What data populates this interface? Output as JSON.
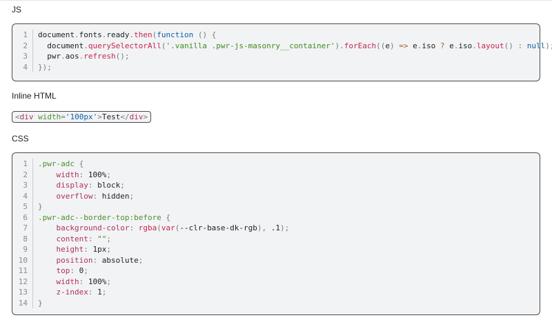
{
  "sections": {
    "js_label": "JS",
    "html_label": "Inline HTML",
    "css_label": "CSS"
  },
  "js_code": [
    {
      "n": "1",
      "tokens": [
        {
          "t": "document",
          "c": "t-obj"
        },
        {
          "t": ".",
          "c": "t-punc"
        },
        {
          "t": "fonts",
          "c": "t-obj"
        },
        {
          "t": ".",
          "c": "t-punc"
        },
        {
          "t": "ready",
          "c": "t-obj"
        },
        {
          "t": ".",
          "c": "t-punc"
        },
        {
          "t": "then",
          "c": "t-fn"
        },
        {
          "t": "(",
          "c": "t-punc"
        },
        {
          "t": "function",
          "c": "t-kw"
        },
        {
          "t": " ",
          "c": "t-obj"
        },
        {
          "t": "()",
          "c": "t-punc"
        },
        {
          "t": " ",
          "c": "t-obj"
        },
        {
          "t": "{",
          "c": "t-punc"
        }
      ]
    },
    {
      "n": "2",
      "tokens": [
        {
          "t": "  document",
          "c": "t-obj"
        },
        {
          "t": ".",
          "c": "t-punc"
        },
        {
          "t": "querySelectorAll",
          "c": "t-fn"
        },
        {
          "t": "(",
          "c": "t-punc"
        },
        {
          "t": "'.vanilla .pwr-js-masonry__container'",
          "c": "t-str"
        },
        {
          "t": ")",
          "c": "t-punc"
        },
        {
          "t": ".",
          "c": "t-punc"
        },
        {
          "t": "forEach",
          "c": "t-fn"
        },
        {
          "t": "((",
          "c": "t-punc"
        },
        {
          "t": "e",
          "c": "t-obj"
        },
        {
          "t": ")",
          "c": "t-punc"
        },
        {
          "t": " => ",
          "c": "t-op"
        },
        {
          "t": "e",
          "c": "t-obj"
        },
        {
          "t": ".",
          "c": "t-punc"
        },
        {
          "t": "iso",
          "c": "t-obj"
        },
        {
          "t": " ? ",
          "c": "t-op"
        },
        {
          "t": "e",
          "c": "t-obj"
        },
        {
          "t": ".",
          "c": "t-punc"
        },
        {
          "t": "iso",
          "c": "t-obj"
        },
        {
          "t": ".",
          "c": "t-punc"
        },
        {
          "t": "layout",
          "c": "t-fn"
        },
        {
          "t": "()",
          "c": "t-punc"
        },
        {
          "t": " : ",
          "c": "t-op"
        },
        {
          "t": "null",
          "c": "t-kw"
        },
        {
          "t": ");",
          "c": "t-punc"
        }
      ]
    },
    {
      "n": "3",
      "tokens": [
        {
          "t": "  pwr",
          "c": "t-obj"
        },
        {
          "t": ".",
          "c": "t-punc"
        },
        {
          "t": "aos",
          "c": "t-obj"
        },
        {
          "t": ".",
          "c": "t-punc"
        },
        {
          "t": "refresh",
          "c": "t-fn"
        },
        {
          "t": "();",
          "c": "t-punc"
        }
      ]
    },
    {
      "n": "4",
      "tokens": [
        {
          "t": "});",
          "c": "t-punc"
        }
      ]
    }
  ],
  "inline_html": [
    {
      "t": "<",
      "c": "t-punc"
    },
    {
      "t": "div",
      "c": "t-tag"
    },
    {
      "t": " ",
      "c": "t-obj"
    },
    {
      "t": "width",
      "c": "t-attr"
    },
    {
      "t": "=",
      "c": "t-punc"
    },
    {
      "t": "'100px'",
      "c": "t-kw"
    },
    {
      "t": ">",
      "c": "t-punc"
    },
    {
      "t": "Test",
      "c": "t-obj"
    },
    {
      "t": "</",
      "c": "t-punc"
    },
    {
      "t": "div",
      "c": "t-tag"
    },
    {
      "t": ">",
      "c": "t-punc"
    }
  ],
  "css_code": [
    {
      "n": "1",
      "tokens": [
        {
          "t": ".pwr-adc",
          "c": "t-sel"
        },
        {
          "t": " {",
          "c": "t-punc"
        }
      ]
    },
    {
      "n": "2",
      "tokens": [
        {
          "t": "    width",
          "c": "t-prop"
        },
        {
          "t": ": ",
          "c": "t-punc"
        },
        {
          "t": "100%",
          "c": "t-val"
        },
        {
          "t": ";",
          "c": "t-punc"
        }
      ]
    },
    {
      "n": "3",
      "tokens": [
        {
          "t": "    display",
          "c": "t-prop"
        },
        {
          "t": ": ",
          "c": "t-punc"
        },
        {
          "t": "block",
          "c": "t-val"
        },
        {
          "t": ";",
          "c": "t-punc"
        }
      ]
    },
    {
      "n": "4",
      "tokens": [
        {
          "t": "    overflow",
          "c": "t-prop"
        },
        {
          "t": ": ",
          "c": "t-punc"
        },
        {
          "t": "hidden",
          "c": "t-val"
        },
        {
          "t": ";",
          "c": "t-punc"
        }
      ]
    },
    {
      "n": "5",
      "tokens": [
        {
          "t": "}",
          "c": "t-punc"
        }
      ]
    },
    {
      "n": "6",
      "tokens": [
        {
          "t": ".pwr-adc--border-top:before",
          "c": "t-sel"
        },
        {
          "t": " {",
          "c": "t-punc"
        }
      ]
    },
    {
      "n": "7",
      "tokens": [
        {
          "t": "    background-color",
          "c": "t-prop"
        },
        {
          "t": ": ",
          "c": "t-punc"
        },
        {
          "t": "rgba",
          "c": "t-fn"
        },
        {
          "t": "(",
          "c": "t-punc"
        },
        {
          "t": "var",
          "c": "t-fn"
        },
        {
          "t": "(",
          "c": "t-punc"
        },
        {
          "t": "--clr-base-dk-rgb",
          "c": "t-val"
        },
        {
          "t": "), ",
          "c": "t-punc"
        },
        {
          "t": ".1",
          "c": "t-val"
        },
        {
          "t": ");",
          "c": "t-punc"
        }
      ]
    },
    {
      "n": "8",
      "tokens": [
        {
          "t": "    content",
          "c": "t-prop"
        },
        {
          "t": ": ",
          "c": "t-punc"
        },
        {
          "t": "\"\"",
          "c": "t-str"
        },
        {
          "t": ";",
          "c": "t-punc"
        }
      ]
    },
    {
      "n": "9",
      "tokens": [
        {
          "t": "    height",
          "c": "t-prop"
        },
        {
          "t": ": ",
          "c": "t-punc"
        },
        {
          "t": "1px",
          "c": "t-val"
        },
        {
          "t": ";",
          "c": "t-punc"
        }
      ]
    },
    {
      "n": "10",
      "tokens": [
        {
          "t": "    position",
          "c": "t-prop"
        },
        {
          "t": ": ",
          "c": "t-punc"
        },
        {
          "t": "absolute",
          "c": "t-val"
        },
        {
          "t": ";",
          "c": "t-punc"
        }
      ]
    },
    {
      "n": "11",
      "tokens": [
        {
          "t": "    top",
          "c": "t-prop"
        },
        {
          "t": ": ",
          "c": "t-punc"
        },
        {
          "t": "0",
          "c": "t-val"
        },
        {
          "t": ";",
          "c": "t-punc"
        }
      ]
    },
    {
      "n": "12",
      "tokens": [
        {
          "t": "    width",
          "c": "t-prop"
        },
        {
          "t": ": ",
          "c": "t-punc"
        },
        {
          "t": "100%",
          "c": "t-val"
        },
        {
          "t": ";",
          "c": "t-punc"
        }
      ]
    },
    {
      "n": "13",
      "tokens": [
        {
          "t": "    z-index",
          "c": "t-prop"
        },
        {
          "t": ": ",
          "c": "t-punc"
        },
        {
          "t": "1",
          "c": "t-val"
        },
        {
          "t": ";",
          "c": "t-punc"
        }
      ]
    },
    {
      "n": "14",
      "tokens": [
        {
          "t": "}",
          "c": "t-punc"
        }
      ]
    }
  ]
}
